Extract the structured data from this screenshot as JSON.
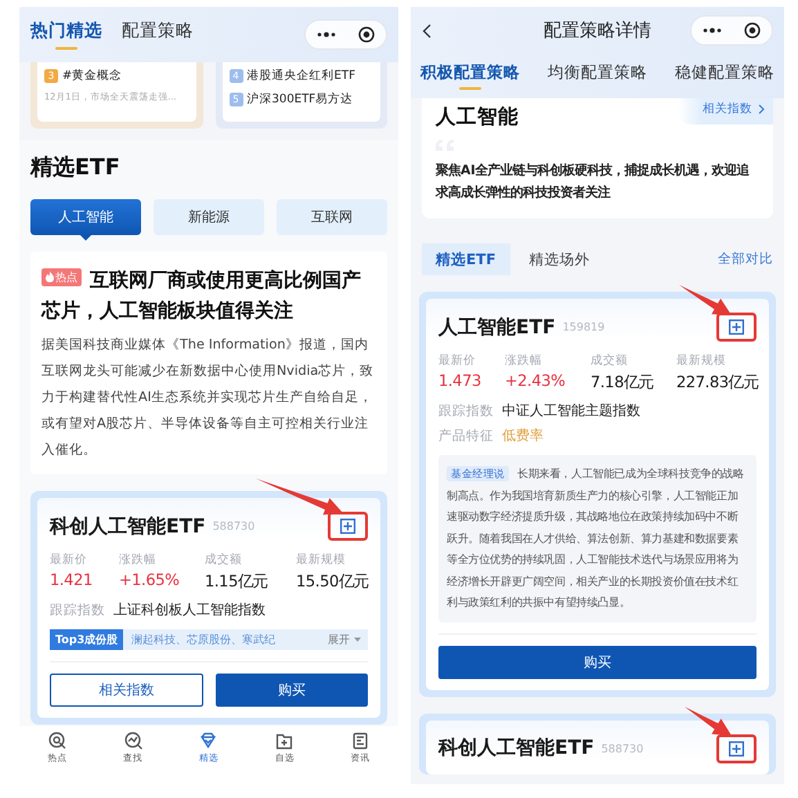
{
  "left_screen": {
    "header": {
      "tabs": [
        {
          "label": "热门精选",
          "selected": true
        },
        {
          "label": "配置策略",
          "selected": false
        }
      ]
    },
    "top_cards": [
      {
        "color": "#f2aa45",
        "items": [
          {
            "rank": "3",
            "title": "#黄金概念",
            "note": "12月1日，市场全天震荡走强..."
          }
        ]
      },
      {
        "color": "#9dbdee",
        "items": [
          {
            "rank": "4",
            "title": "港股通央企红利ETF"
          },
          {
            "rank": "5",
            "title": "沪深300ETF易方达"
          }
        ]
      }
    ],
    "section_title": "精选ETF",
    "category_tabs": [
      {
        "label": "人工智能",
        "selected": true
      },
      {
        "label": "新能源",
        "selected": false
      },
      {
        "label": "互联网",
        "selected": false
      }
    ],
    "article": {
      "badge": "热点",
      "title": "互联网厂商或使用更高比例国产芯片，人工智能板块值得关注",
      "body": "据美国科技商业媒体《The Information》报道，国内互联网龙头可能减少在新数据中心使用Nvidia芯片，致力于构建替代性AI生态系统并实现芯片生产自给自足，或有望对A股芯片、半导体设备等自主可控相关行业注入催化。"
    },
    "fund_card": {
      "name": "科创人工智能ETF",
      "code": "588730",
      "stats": [
        {
          "label": "最新价",
          "value": "1.421",
          "kind": "rise"
        },
        {
          "label": "涨跌幅",
          "value": "+1.65%",
          "kind": "rise"
        },
        {
          "label": "成交额",
          "value": "1.15亿元",
          "kind": "plain"
        },
        {
          "label": "最新规模",
          "value": "15.50亿元",
          "kind": "plain"
        }
      ],
      "tracking": {
        "label": "跟踪指数",
        "value": "上证科创板人工智能指数"
      },
      "holdings": {
        "label": "Top3成份股",
        "value": "澜起科技、芯原股份、寒武纪",
        "toggle": "展开"
      },
      "buttons": [
        {
          "label": "相关指数",
          "kind": "outline"
        },
        {
          "label": "购买",
          "kind": "solid"
        }
      ]
    },
    "nav": [
      {
        "label": "热点",
        "selected": false
      },
      {
        "label": "查找",
        "selected": false
      },
      {
        "label": "精选",
        "selected": true
      },
      {
        "label": "自选",
        "selected": false
      },
      {
        "label": "资讯",
        "selected": false
      }
    ]
  },
  "right_screen": {
    "header": {
      "title": "配置策略详情"
    },
    "strategy_tabs": [
      {
        "label": "积极配置策略",
        "selected": true
      },
      {
        "label": "均衡配置策略",
        "selected": false
      },
      {
        "label": "稳健配置策略",
        "selected": false
      }
    ],
    "theme_card": {
      "title": "人工智能",
      "link": "相关指数",
      "description": "聚焦AI全产业链与科创板硬科技，捕捉成长机遇，欢迎追求高成长弹性的科技投资者关注"
    },
    "fund_tabs": [
      {
        "label": "精选ETF",
        "selected": true
      },
      {
        "label": "精选场外",
        "selected": false
      }
    ],
    "compare_link": "全部对比",
    "fund_cards": [
      {
        "name": "人工智能ETF",
        "code": "159819",
        "stats": [
          {
            "label": "最新价",
            "value": "1.473",
            "kind": "rise"
          },
          {
            "label": "涨跌幅",
            "value": "+2.43%",
            "kind": "rise"
          },
          {
            "label": "成交额",
            "value": "7.18亿元",
            "kind": "plain"
          },
          {
            "label": "最新规模",
            "value": "227.83亿元",
            "kind": "plain"
          }
        ],
        "tracking": {
          "label": "跟踪指数",
          "value": "中证人工智能主题指数"
        },
        "feature": {
          "label": "产品特征",
          "value": "低费率"
        },
        "manager": {
          "badge": "基金经理说",
          "text": "长期来看，人工智能已成为全球科技竞争的战略制高点。作为我国培育新质生产力的核心引擎，人工智能正加速驱动数字经济提质升级，其战略地位在政策持续加码中不断跃升。随着我国在人才供给、算法创新、算力基建和数据要素等全方位优势的持续巩固，人工智能技术迭代与场景应用将为经济增长开辟更广阔空间，相关产业的长期投资价值在技术红利与政策红利的共振中有望持续凸显。"
        },
        "buttons": [
          {
            "label": "购买",
            "kind": "solid"
          }
        ]
      },
      {
        "name": "科创人工智能ETF",
        "code": "588730"
      }
    ]
  }
}
